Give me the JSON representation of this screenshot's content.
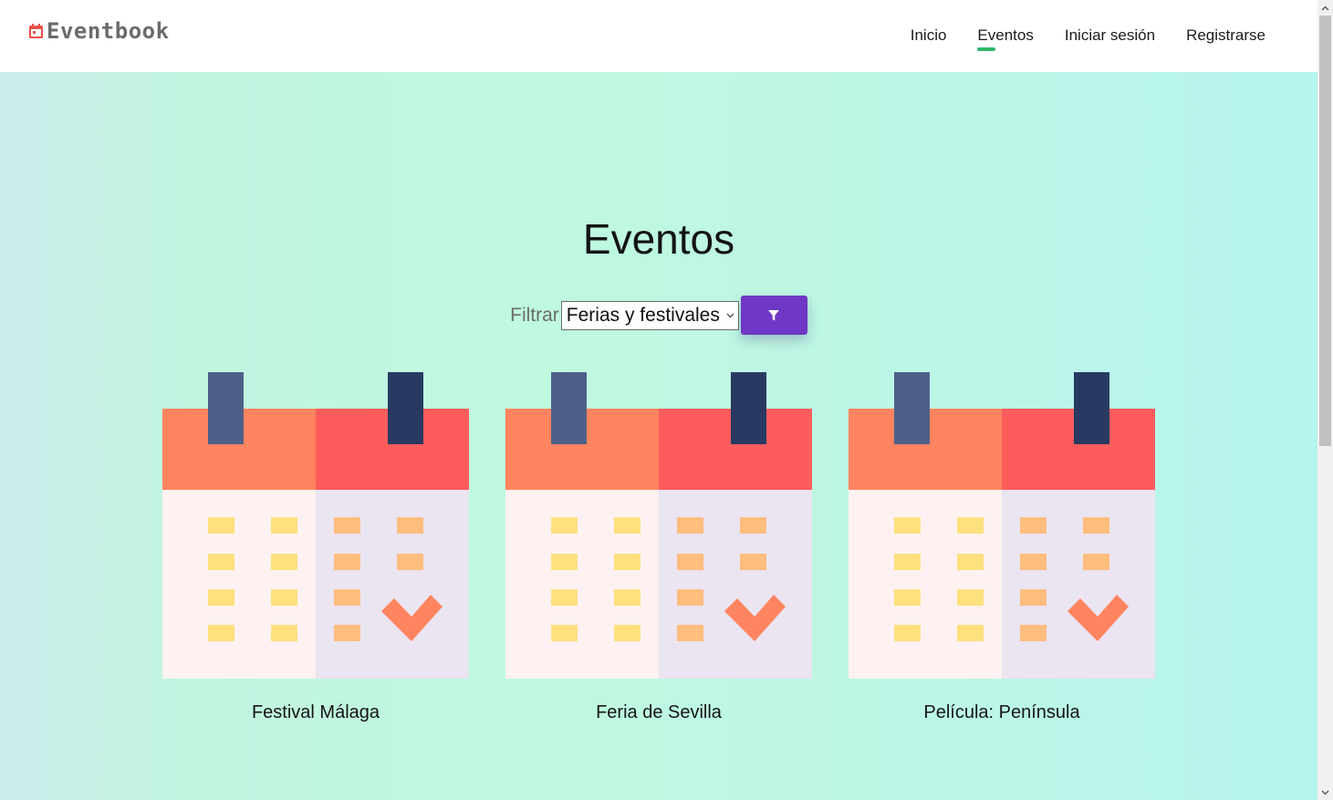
{
  "header": {
    "logo_text": "Eventbook",
    "nav": [
      {
        "label": "Inicio"
      },
      {
        "label": "Eventos",
        "active": true
      },
      {
        "label": "Iniciar sesión"
      },
      {
        "label": "Registrarse"
      }
    ]
  },
  "main": {
    "title": "Eventos",
    "filter": {
      "label": "Filtrar",
      "selected": "Ferias y festivales",
      "button_icon": "filter-icon"
    },
    "events": [
      {
        "title": "Festival Málaga",
        "icon": "calendar-icon"
      },
      {
        "title": "Feria de Sevilla",
        "icon": "calendar-icon"
      },
      {
        "title": "Película: Península",
        "icon": "calendar-icon"
      }
    ]
  },
  "colors": {
    "accent_button": "#6f37c5",
    "active_nav_indicator": "#2fb86b",
    "logo_icon": "#e8504a"
  }
}
